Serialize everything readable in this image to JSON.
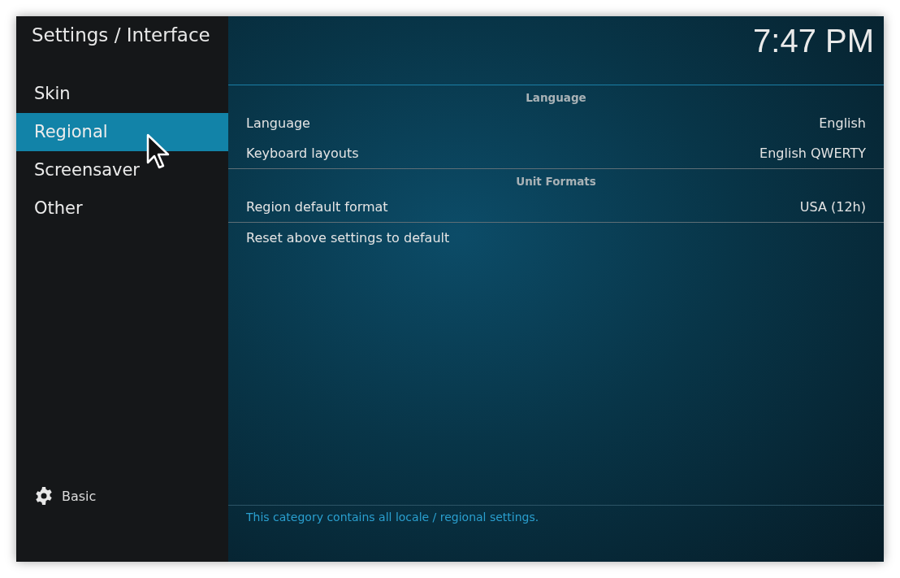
{
  "window": {
    "title": "Settings / Interface"
  },
  "clock": "7:47 PM",
  "sidebar": {
    "items": [
      {
        "label": "Skin",
        "selected": false
      },
      {
        "label": "Regional",
        "selected": true
      },
      {
        "label": "Screensaver",
        "selected": false
      },
      {
        "label": "Other",
        "selected": false
      }
    ],
    "level_button": {
      "label": "Basic"
    }
  },
  "sections": [
    {
      "header": "Language",
      "rows": [
        {
          "label": "Language",
          "value": "English"
        },
        {
          "label": "Keyboard layouts",
          "value": "English QWERTY"
        }
      ]
    },
    {
      "header": "Unit Formats",
      "rows": [
        {
          "label": "Region default format",
          "value": "USA (12h)"
        }
      ]
    }
  ],
  "actions": [
    {
      "label": "Reset above settings to default"
    }
  ],
  "description": "This category contains all locale / regional settings."
}
